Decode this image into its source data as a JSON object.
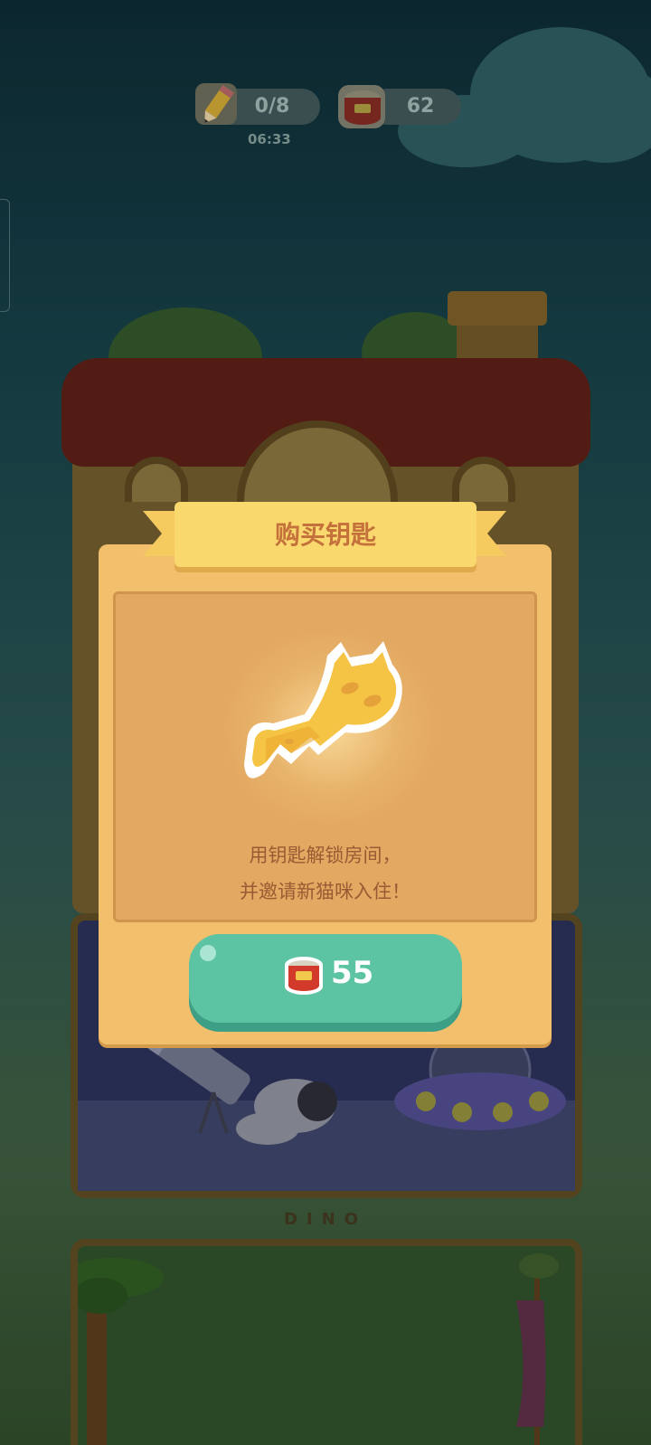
{
  "hud": {
    "progress_text": "0/8",
    "timer": "06:33",
    "coins": "62"
  },
  "modal": {
    "title": "购买钥匙",
    "description_line1": "用钥匙解锁房间，",
    "description_line2": "并邀请新猫咪入住！",
    "price": "55"
  },
  "rooms": {
    "dino_label": "DINO"
  },
  "icons": {
    "progress": "pencil-icon",
    "currency": "cat-food-can-icon",
    "key": "cat-key-icon"
  },
  "colors": {
    "modal_bg": "#f2bf6c",
    "ribbon": "#f9d86e",
    "button": "#5cc3a3",
    "title_text": "#c4713b",
    "desc_text": "#9b5a33"
  }
}
